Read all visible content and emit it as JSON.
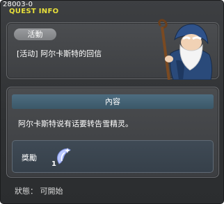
{
  "window": {
    "quest_id": "28003-0",
    "title": "QUEST INFO"
  },
  "quest": {
    "category_badge": "活動",
    "name": "[活动] 阿尔卡斯特的回信",
    "npc_icon": "wizard-npc-portrait"
  },
  "content": {
    "header": "內容",
    "description": "阿尔卡斯特说有话要转告雪精灵。"
  },
  "reward": {
    "label": "獎勵",
    "item_icon": "snow-crystal-icon",
    "quantity": "1"
  },
  "status": {
    "text": "狀態： 可開始"
  },
  "colors": {
    "title": "#e8e03a",
    "section_header": "#44636f",
    "badge": "#8c8e91"
  }
}
